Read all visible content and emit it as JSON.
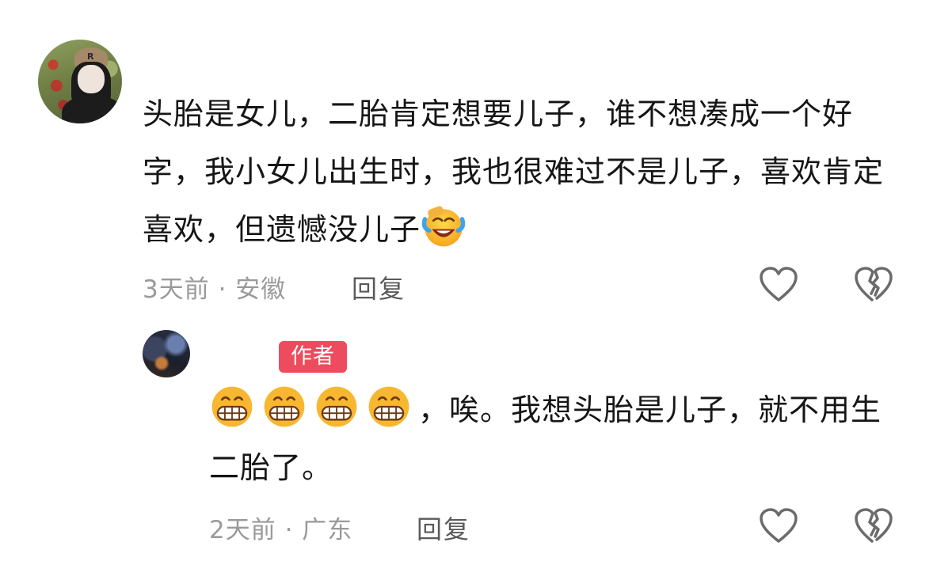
{
  "comments": [
    {
      "text": "头胎是女儿，二胎肯定想要儿子，谁不想凑成一个好字，我小女儿出生时，我也很难过不是儿子，喜欢肯定喜欢，但遗憾没儿子",
      "emoji": "laughing-tears-emoji",
      "meta": "3天前 · 安徽",
      "reply_label": "回复"
    }
  ],
  "reply": {
    "badge": "作者",
    "emoji": "grinning-emoji",
    "emoji_count": 4,
    "text": "，唉。我想头胎是儿子，就不用生二胎了。",
    "meta": "2天前 · 广东",
    "reply_label": "回复"
  },
  "icons": {
    "like": "heart-icon",
    "dislike": "broken-heart-icon"
  },
  "colors": {
    "badge": "#ec4c5e",
    "meta_text": "#9a9a9a",
    "icon_stroke": "#6b6b6b"
  }
}
